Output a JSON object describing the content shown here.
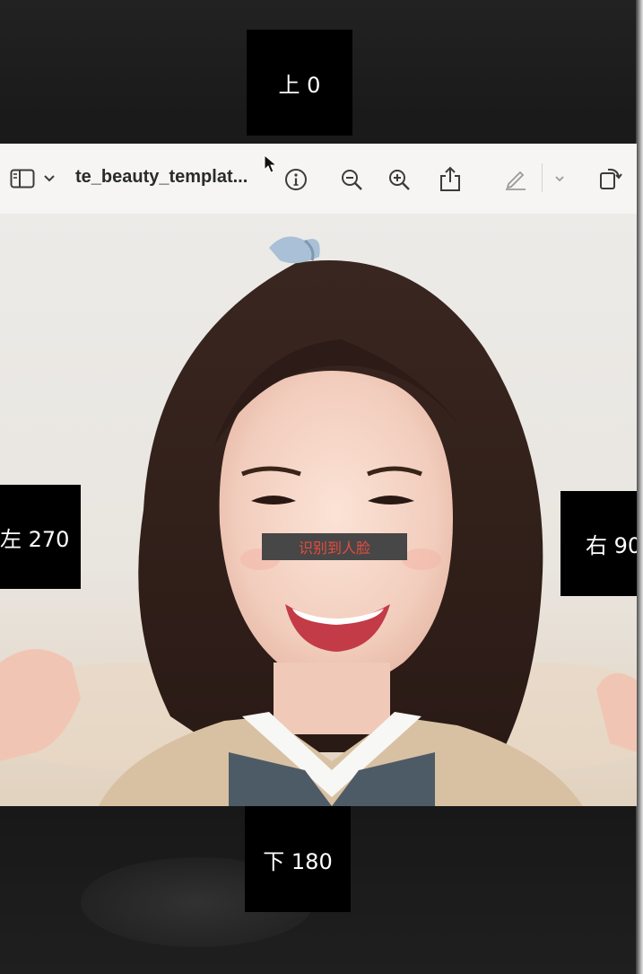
{
  "viewer": {
    "title": "te_beauty_templat...",
    "toolbar": {
      "sidebar_icon": "sidebar-toggle-icon",
      "chevron_icon": "chevron-down-icon",
      "info_icon": "info-icon",
      "zoom_out_icon": "zoom-out-icon",
      "zoom_in_icon": "zoom-in-icon",
      "share_icon": "share-icon",
      "markup_icon": "markup-pen-icon",
      "rotate_icon": "rotate-icon"
    }
  },
  "overlays": {
    "top": "上 0",
    "left": "左 270",
    "right": "右 90",
    "bottom": "下 180",
    "face_detected": "识别到人脸"
  },
  "colors": {
    "overlay_bg": "#000000",
    "face_tag_bg": "#474747",
    "face_tag_text": "#e64b3c",
    "toolbar_bg": "#f6f5f4"
  }
}
